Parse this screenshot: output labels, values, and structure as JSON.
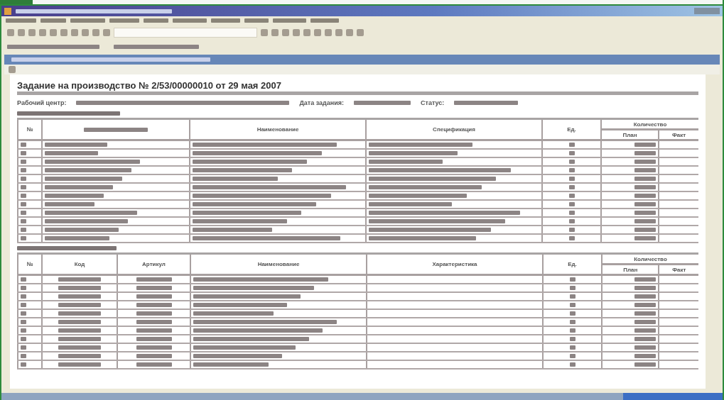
{
  "document": {
    "heading": "Задание на производство № 2/53/00000010 от 29 мая 2007",
    "fields": [
      {
        "label": "Рабочий центр:"
      },
      {
        "label": "Дата задания:"
      },
      {
        "label": "Статус:"
      }
    ],
    "products": {
      "columns": [
        "№",
        "",
        "Наименование",
        "Спецификация",
        "Ед.",
        "Количество"
      ],
      "subcolumns": [
        "План",
        "Факт"
      ]
    },
    "components": {
      "columns": [
        "№",
        "Код",
        "Артикул",
        "Наименование",
        "Характеристика",
        "Ед.",
        "Количество"
      ],
      "subcolumns": [
        "План",
        "Факт"
      ]
    }
  }
}
